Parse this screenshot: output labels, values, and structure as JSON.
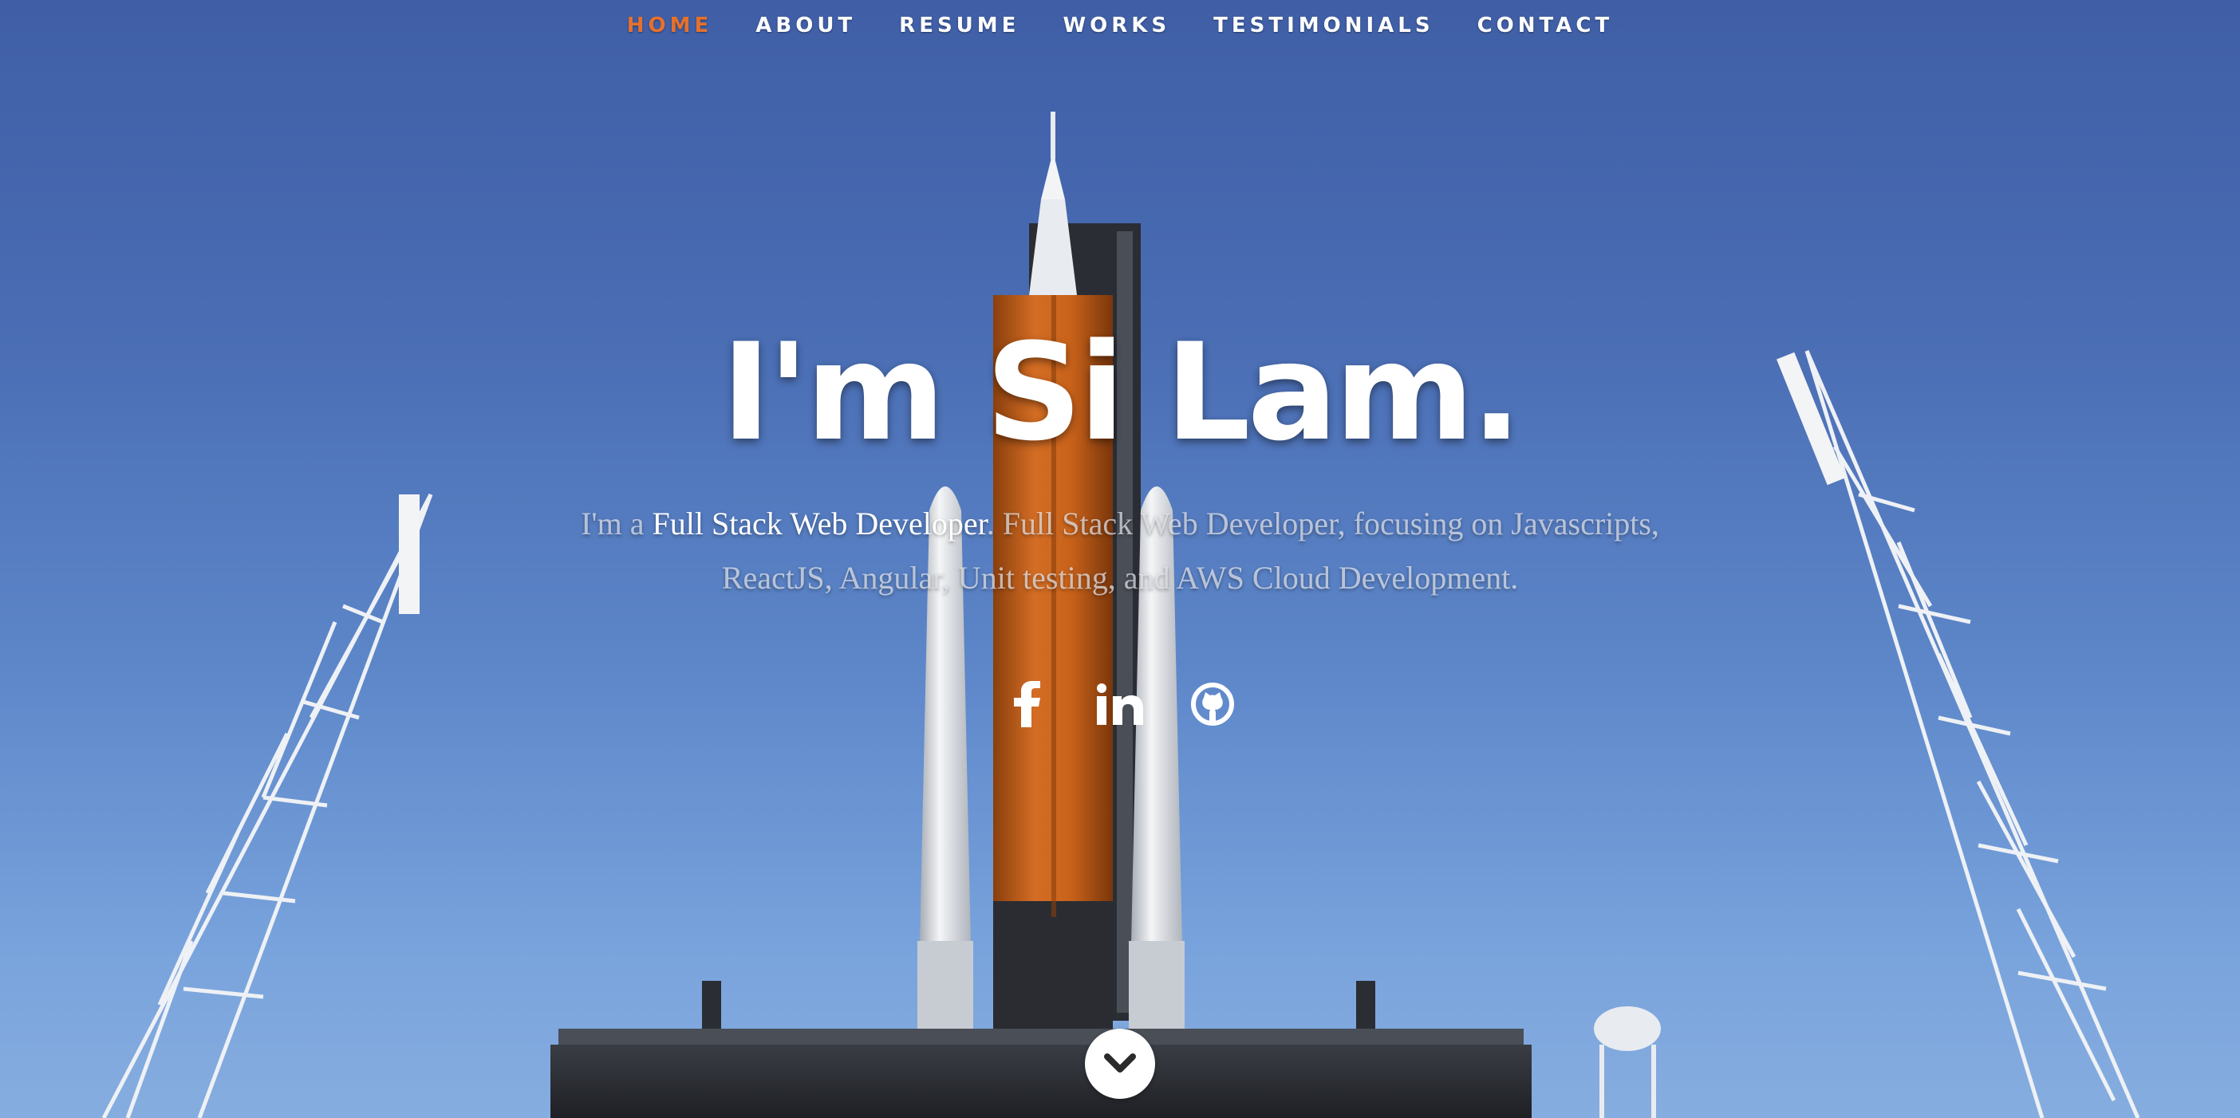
{
  "nav": {
    "items": [
      {
        "label": "HOME",
        "active": true
      },
      {
        "label": "ABOUT",
        "active": false
      },
      {
        "label": "RESUME",
        "active": false
      },
      {
        "label": "WORKS",
        "active": false
      },
      {
        "label": "TESTIMONIALS",
        "active": false
      },
      {
        "label": "CONTACT",
        "active": false
      }
    ],
    "active_color": "#e5712d"
  },
  "banner": {
    "headline": "I'm Si Lam.",
    "intro_prefix": "I'm a ",
    "intro_role": "Full Stack Web Developer",
    "intro_rest": ". Full Stack Web Developer, focusing on Javascripts, ReactJS, Angular, Unit testing, and AWS Cloud Development."
  },
  "social": [
    {
      "icon": "facebook-icon"
    },
    {
      "icon": "linkedin-icon"
    },
    {
      "icon": "github-icon"
    }
  ],
  "scroll": {
    "icon": "chevron-down-icon"
  },
  "background": {
    "description_icon": "rocket-launch-background",
    "sky_color": "#4a6db4",
    "accent_color": "#c8621a"
  }
}
